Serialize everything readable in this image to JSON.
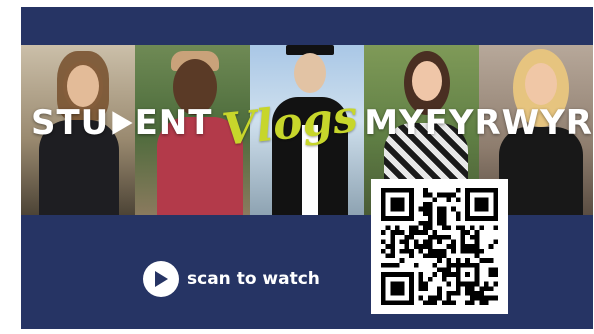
{
  "banner": {
    "title_part1": "STU",
    "title_part2": "ENT",
    "title_script": "Vlogs",
    "title_part3": "MYFYRWYR",
    "colors": {
      "background": "#263464",
      "accent": "#c7d62b",
      "text": "#ffffff"
    }
  },
  "cta": {
    "label": "scan to watch",
    "icon": "play-circle-icon"
  },
  "qr": {
    "icon": "qr-code-icon"
  },
  "photos": [
    {
      "name": "student-photo-1"
    },
    {
      "name": "student-photo-2"
    },
    {
      "name": "student-photo-3"
    },
    {
      "name": "student-photo-4"
    },
    {
      "name": "student-photo-5"
    }
  ]
}
